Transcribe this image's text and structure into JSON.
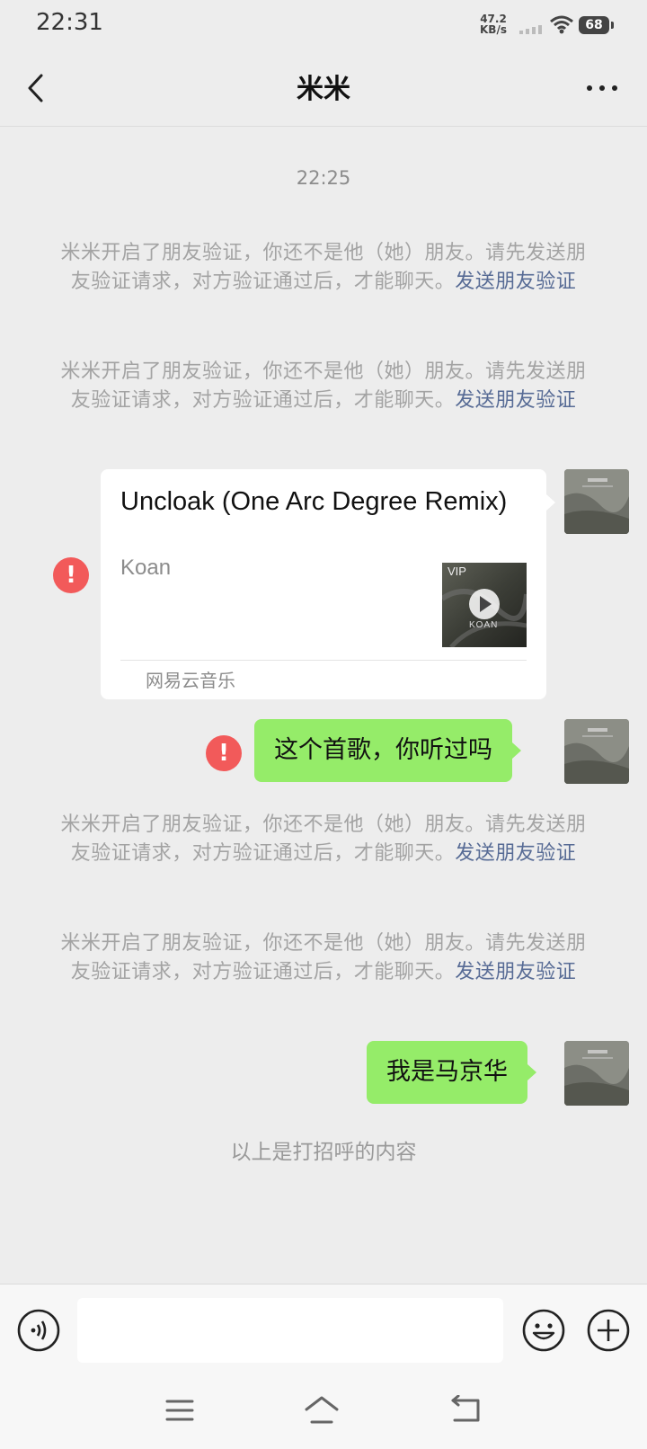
{
  "status_bar": {
    "time": "22:31",
    "net_speed_value": "47.2",
    "net_speed_unit": "KB/s",
    "battery": "68"
  },
  "header": {
    "title": "米米",
    "back_icon": "chevron-left-icon",
    "more_icon": "more-horizontal-icon"
  },
  "messages": {
    "timestamp": "22:25",
    "system_notice_text": "米米开启了朋友验证，你还不是他（她）朋友。请先发送朋友验证请求，对方验证通过后，才能聊天。",
    "system_notice_link": "发送朋友验证",
    "music_card": {
      "title": "Uncloak (One Arc Degree Remix)",
      "artist": "Koan",
      "badge": "VIP",
      "source": "网易云音乐",
      "cover_text": "KOAN"
    },
    "text_message_1": "这个首歌，你听过吗",
    "text_message_2": "我是马京华",
    "error_mark": "!",
    "greeting_end": "以上是打招呼的内容"
  },
  "input_bar": {
    "voice_icon": "voice-icon",
    "emoji_icon": "emoji-icon",
    "plus_icon": "plus-circle-icon",
    "input_value": ""
  },
  "colors": {
    "background": "#ededed",
    "sent_bubble": "#95ec69",
    "link": "#576b95",
    "error": "#f25a5a"
  }
}
